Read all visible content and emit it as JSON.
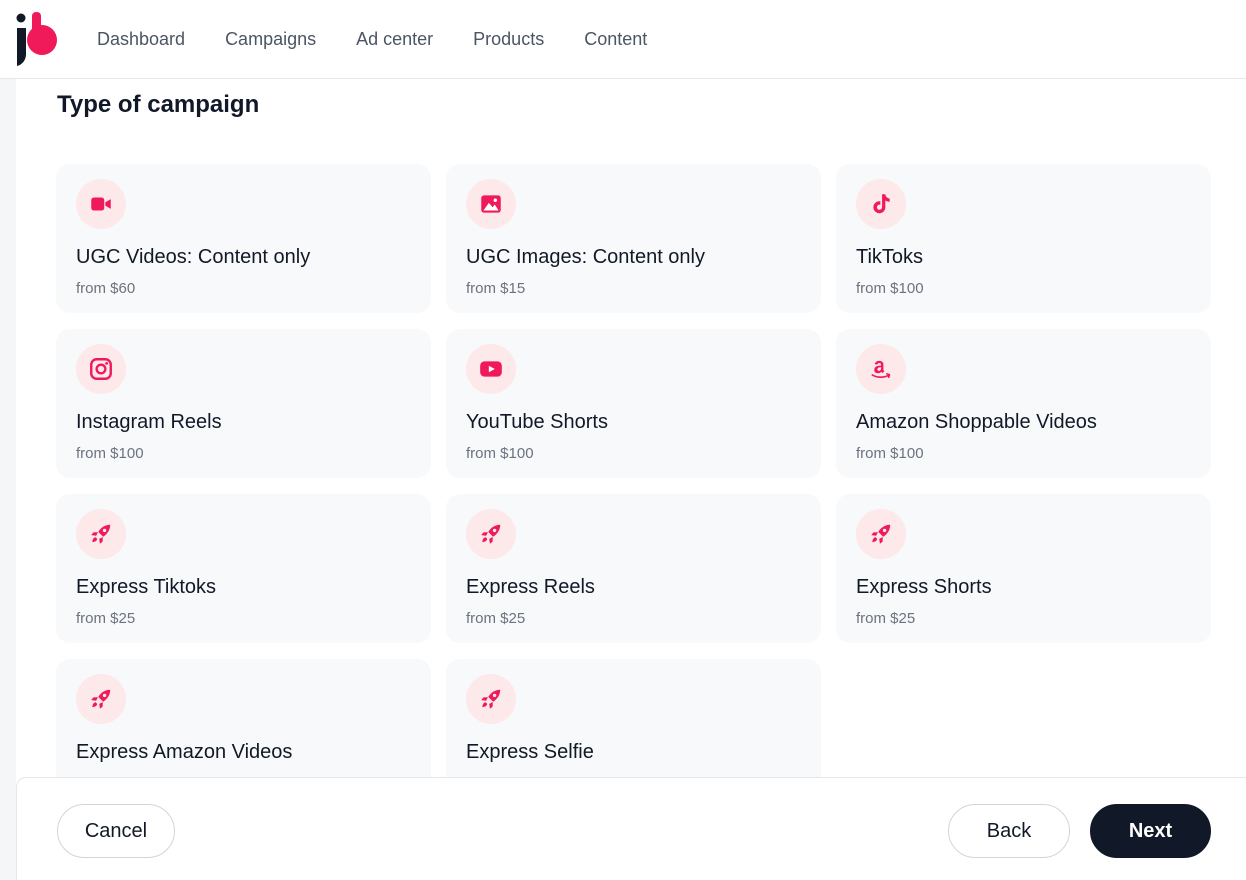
{
  "nav": {
    "items": [
      "Dashboard",
      "Campaigns",
      "Ad center",
      "Products",
      "Content"
    ]
  },
  "page": {
    "title": "Type of campaign"
  },
  "colors": {
    "accent": "#f0195a",
    "icon_bg": "#fde8ea",
    "card_bg": "#f8f9fa",
    "dark_button": "#111827"
  },
  "cards": [
    {
      "title": "UGC Videos: Content only",
      "price": "from $60",
      "icon": "video-camera-icon"
    },
    {
      "title": "UGC Images: Content only",
      "price": "from $15",
      "icon": "image-icon"
    },
    {
      "title": "TikToks",
      "price": "from $100",
      "icon": "tiktok-icon"
    },
    {
      "title": "Instagram Reels",
      "price": "from $100",
      "icon": "instagram-icon"
    },
    {
      "title": "YouTube Shorts",
      "price": "from $100",
      "icon": "youtube-icon"
    },
    {
      "title": "Amazon Shoppable Videos",
      "price": "from $100",
      "icon": "amazon-icon"
    },
    {
      "title": "Express Tiktoks",
      "price": "from $25",
      "icon": "rocket-icon"
    },
    {
      "title": "Express Reels",
      "price": "from $25",
      "icon": "rocket-icon"
    },
    {
      "title": "Express Shorts",
      "price": "from $25",
      "icon": "rocket-icon"
    },
    {
      "title": "Express Amazon Videos",
      "price": "",
      "icon": "rocket-icon"
    },
    {
      "title": "Express Selfie",
      "price": "",
      "icon": "rocket-icon"
    }
  ],
  "footer": {
    "cancel_label": "Cancel",
    "back_label": "Back",
    "next_label": "Next"
  }
}
